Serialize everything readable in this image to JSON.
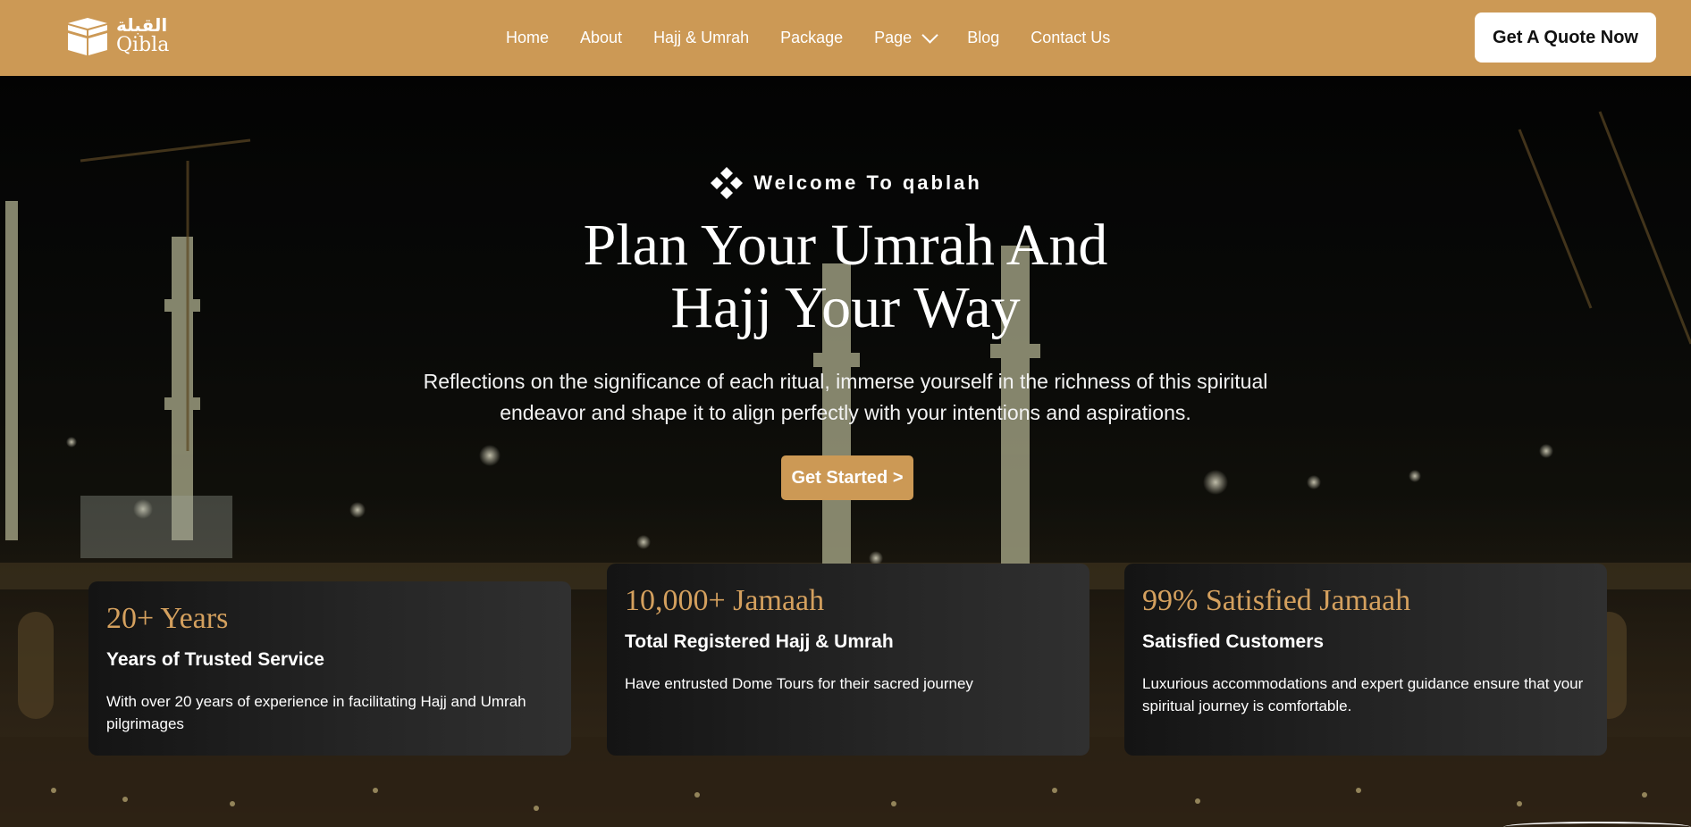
{
  "brand": {
    "name_ar": "القبلة",
    "name_en": "Qibla",
    "accent": "#cc9955",
    "logo_icon": "kaaba-icon"
  },
  "nav": {
    "items": [
      {
        "label": "Home"
      },
      {
        "label": "About"
      },
      {
        "label": "Hajj & Umrah"
      },
      {
        "label": "Package"
      },
      {
        "label": "Page",
        "has_dropdown": true
      },
      {
        "label": "Blog"
      },
      {
        "label": "Contact Us"
      }
    ],
    "cta_label": "Get A Quote Now"
  },
  "hero": {
    "background": "night photo of Masjid al-Haram with minarets and cranes",
    "welcome_icon": "diamond-cluster-icon",
    "welcome_text": "Welcome To qablah",
    "title_line1": "Plan Your Umrah And",
    "title_line2": "Hajj Your Way",
    "subtitle_line1": "Reflections on the significance of each ritual, immerse yourself in the richness of this spiritual",
    "subtitle_line2": "endeavor and shape it to align perfectly with your intentions and aspirations.",
    "cta_label": "Get Started >"
  },
  "stats": [
    {
      "number": "20+ Years",
      "heading": "Years of Trusted Service",
      "description": "With over 20 years of experience in facilitating Hajj and Umrah pilgrimages"
    },
    {
      "number": "10,000+ Jamaah",
      "heading": "Total Registered Hajj & Umrah",
      "description": "Have entrusted Dome Tours for their sacred journey"
    },
    {
      "number": "99% Satisfied Jamaah",
      "heading": "Satisfied Customers",
      "description": "Luxurious accommodations and expert guidance ensure that your spiritual journey is comfortable."
    }
  ]
}
